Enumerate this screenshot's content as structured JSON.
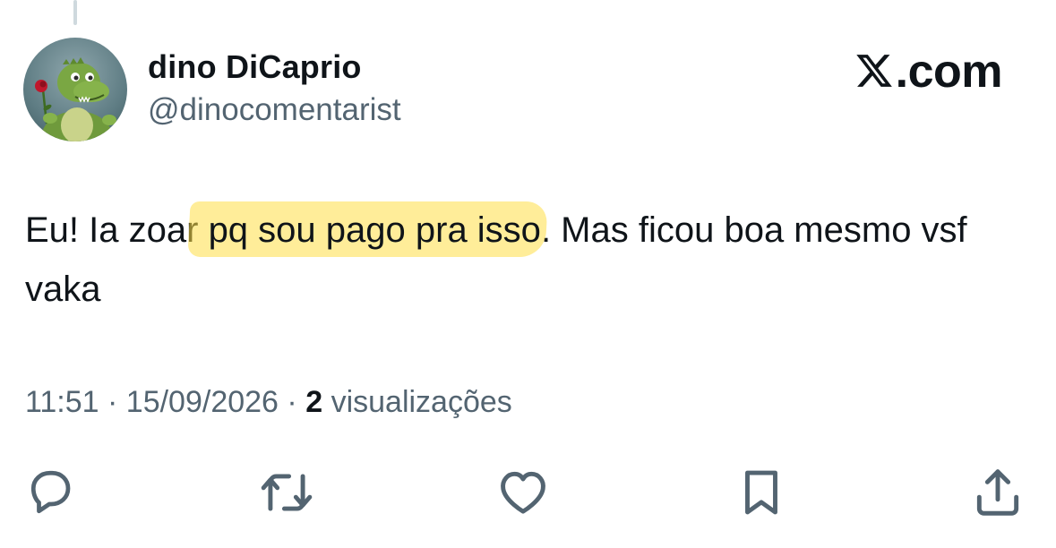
{
  "user": {
    "display_name": "dino DiCaprio",
    "handle": "@dinocomentarist",
    "avatar_icon": "dinosaur-with-rose-avatar"
  },
  "brand": {
    "text": ".com",
    "icon": "x-logo-icon"
  },
  "tweet": {
    "text_before": "Eu! Ia zoar ",
    "text_highlight": "pq sou pago pra isso",
    "text_after": ". Mas ficou boa mesmo vsf vaka",
    "highlight_color": "#ffde46"
  },
  "meta": {
    "time": "11:51",
    "separator": "·",
    "date": "15/09/2026",
    "views_count": "2",
    "views_label": "visualizações"
  },
  "actions": [
    {
      "name": "reply",
      "icon": "speech-bubble-icon"
    },
    {
      "name": "repost",
      "icon": "repost-arrows-icon"
    },
    {
      "name": "like",
      "icon": "heart-icon"
    },
    {
      "name": "bookmark",
      "icon": "bookmark-icon"
    },
    {
      "name": "share",
      "icon": "share-upload-icon"
    }
  ],
  "colors": {
    "text": "#0f1419",
    "secondary": "#536471",
    "icon": "#536471"
  }
}
